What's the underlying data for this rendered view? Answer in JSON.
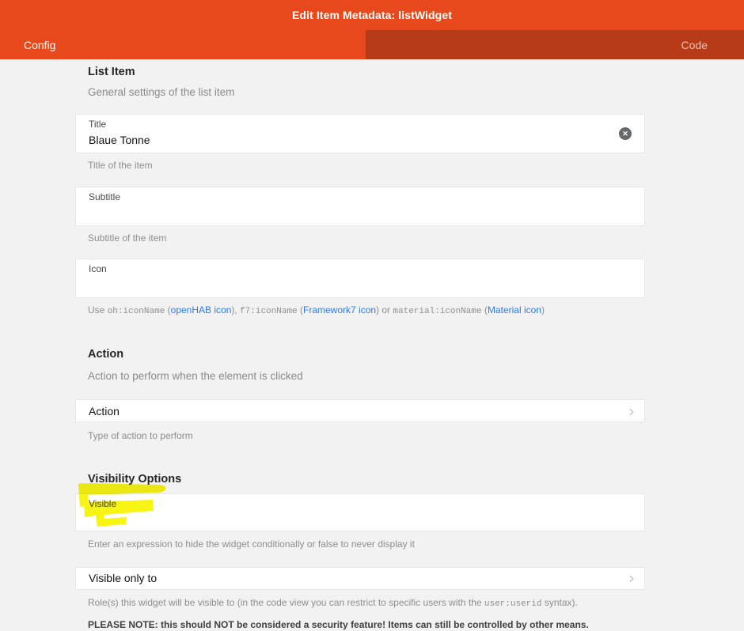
{
  "colors": {
    "header_orange": "#e8491c",
    "tab_inactive_dark": "#b73b16",
    "page_background": "#f2f2f2",
    "link_blue": "#2b7af7",
    "highlight_yellow": "#f7f400",
    "clear_icon_gray": "#67696e"
  },
  "header": {
    "title": "Edit Item Metadata: listWidget",
    "tabs": {
      "config": "Config",
      "code": "Code"
    }
  },
  "icons": {
    "clear_icon": "✕",
    "chevron_icon": "›"
  },
  "list_item": {
    "heading": "List Item",
    "description": "General settings of the list item",
    "title_field": {
      "label": "Title",
      "value": "Blaue Tonne",
      "hint": "Title of the item"
    },
    "subtitle_field": {
      "label": "Subtitle",
      "value": "",
      "hint": "Subtitle of the item"
    },
    "icon_field": {
      "label": "Icon",
      "value": "",
      "hint": {
        "t1": "Use ",
        "code1": "oh:iconName",
        "t2": " (",
        "link1": "openHAB icon",
        "t3": "), ",
        "code2": "f7:iconName",
        "t4": " (",
        "link2": "Framework7 icon",
        "t5": ") or ",
        "code3": "material:iconName",
        "t6": " (",
        "link3": "Material icon",
        "t7": ")"
      }
    }
  },
  "action": {
    "heading": "Action",
    "description": "Action to perform when the element is clicked",
    "row_label": "Action",
    "hint": "Type of action to perform"
  },
  "visibility": {
    "heading": "Visibility Options",
    "visible_field": {
      "label": "Visible",
      "value": "",
      "hint": "Enter an expression to hide the widget conditionally or false to never display it"
    },
    "visible_only_to": {
      "label": "Visible only to",
      "hint": {
        "t1": "Role(s) this widget will be visible to (in the code view you can restrict to specific users with the ",
        "code1": "user:userid",
        "t2": " syntax)."
      },
      "note": "PLEASE NOTE: this should NOT be considered a security feature! Items can still be controlled by other means."
    }
  }
}
